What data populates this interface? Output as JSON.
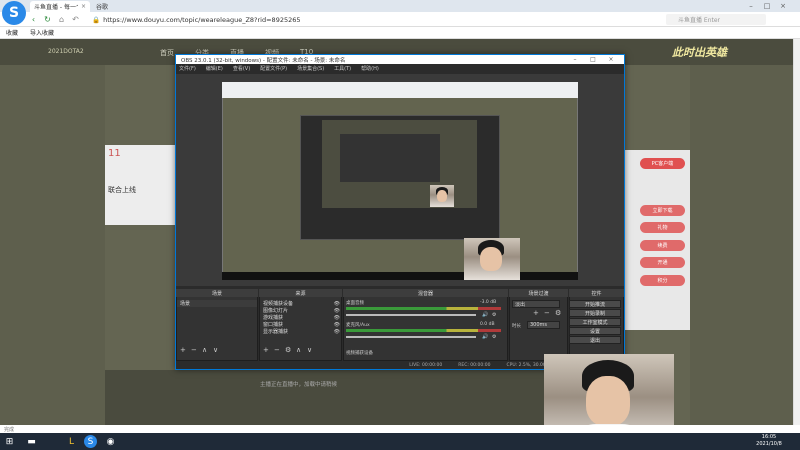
{
  "browser": {
    "tabs": [
      {
        "title": "斗鱼直播 - 每一个人的直播平台",
        "active": true
      },
      {
        "title": "谷歌",
        "active": false
      }
    ],
    "url": "https://www.douyu.com/topic/weareleague_Z8?rid=8925265",
    "search_placeholder": "斗鱼直播 Enter",
    "bookmarks": [
      "收藏",
      "导入收藏"
    ],
    "status_text": "完成"
  },
  "site": {
    "logo_text": "2021DOTA2",
    "nav": [
      "首页",
      "分类",
      "直播",
      "视频",
      "T10"
    ],
    "game_art_text": "此时出英雄",
    "left_card": {
      "number": "11",
      "title": "联合上线"
    },
    "right_tags": [
      "PC客户端",
      "立即下载",
      "礼物",
      "续费",
      "开通",
      "积分"
    ],
    "player_hint": "主播正在直播中，加载中请稍候"
  },
  "obs": {
    "title": "OBS 23.0.1 (32-bit, windows) - 配置文件: 未命名 - 场景: 未命名",
    "menu": [
      "文件(F)",
      "编辑(E)",
      "查看(V)",
      "配置文件(P)",
      "场景集合(S)",
      "工具(T)",
      "帮助(H)"
    ],
    "docks": {
      "scenes_title": "场景",
      "sources_title": "来源",
      "mixer_title": "混音器",
      "transitions_title": "场景过渡",
      "controls_title": "控件"
    },
    "scenes": [
      "场景"
    ],
    "sources": [
      "视频捕获设备",
      "图像幻灯片",
      "游戏捕获",
      "窗口捕获",
      "显示器捕获"
    ],
    "mixer": [
      {
        "label": "桌面音频",
        "db": "-3.0 dB"
      },
      {
        "label": "麦克风/Aux",
        "db": "0.0 dB"
      },
      {
        "label": "视频捕获设备",
        "db": ""
      }
    ],
    "transition": {
      "type": "淡出",
      "duration_label": "时长",
      "duration_value": "300ms"
    },
    "controls": [
      "开始推流",
      "开始录制",
      "工作室模式",
      "设置",
      "退出"
    ],
    "status": {
      "live": "LIVE: 00:00:00",
      "rec": "REC: 00:00:00",
      "cpu": "CPU: 2.5%, 30.00 fps"
    }
  },
  "taskbar": {
    "time": "16:05",
    "date": "2021/10/8"
  }
}
